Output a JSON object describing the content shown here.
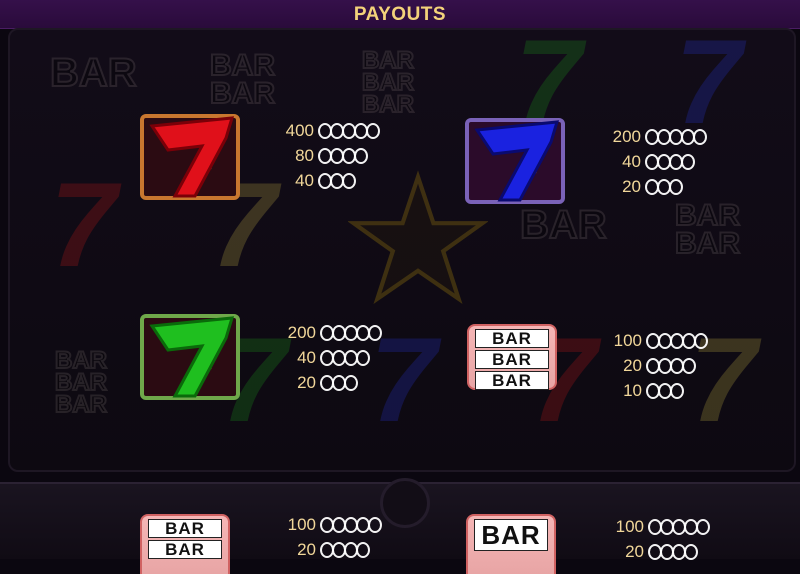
{
  "header": {
    "title": "PAYOUTS"
  },
  "background": {
    "bar_words": [
      "BAR",
      "BAR",
      "BAR"
    ]
  },
  "symbols": [
    {
      "id": "red-seven",
      "icon": "red-seven-icon",
      "color": "#e0101a",
      "frame_color": "#c8772f",
      "payouts": [
        {
          "value": "400",
          "coins": 5
        },
        {
          "value": "80",
          "coins": 4
        },
        {
          "value": "40",
          "coins": 3
        }
      ]
    },
    {
      "id": "blue-seven",
      "icon": "blue-seven-icon",
      "color": "#1a22e0",
      "frame_color": "#7a62b8",
      "payouts": [
        {
          "value": "200",
          "coins": 5
        },
        {
          "value": "40",
          "coins": 4
        },
        {
          "value": "20",
          "coins": 3
        }
      ]
    },
    {
      "id": "green-seven",
      "icon": "green-seven-icon",
      "color": "#1fbf1f",
      "frame_color": "#6fa84a",
      "payouts": [
        {
          "value": "200",
          "coins": 5
        },
        {
          "value": "40",
          "coins": 4
        },
        {
          "value": "20",
          "coins": 3
        }
      ]
    },
    {
      "id": "triple-bar",
      "icon": "triple-bar-icon",
      "bar_lines": [
        "BAR",
        "BAR",
        "BAR"
      ],
      "payouts": [
        {
          "value": "100",
          "coins": 5
        },
        {
          "value": "20",
          "coins": 4
        },
        {
          "value": "10",
          "coins": 3
        }
      ]
    },
    {
      "id": "double-bar",
      "icon": "double-bar-icon",
      "bar_lines": [
        "BAR",
        "BAR"
      ],
      "payouts": [
        {
          "value": "100",
          "coins": 5
        },
        {
          "value": "20",
          "coins": 4
        }
      ]
    },
    {
      "id": "single-bar",
      "icon": "single-bar-icon",
      "bar_lines": [
        "BAR"
      ],
      "payouts": [
        {
          "value": "100",
          "coins": 5
        },
        {
          "value": "20",
          "coins": 4
        }
      ]
    }
  ]
}
